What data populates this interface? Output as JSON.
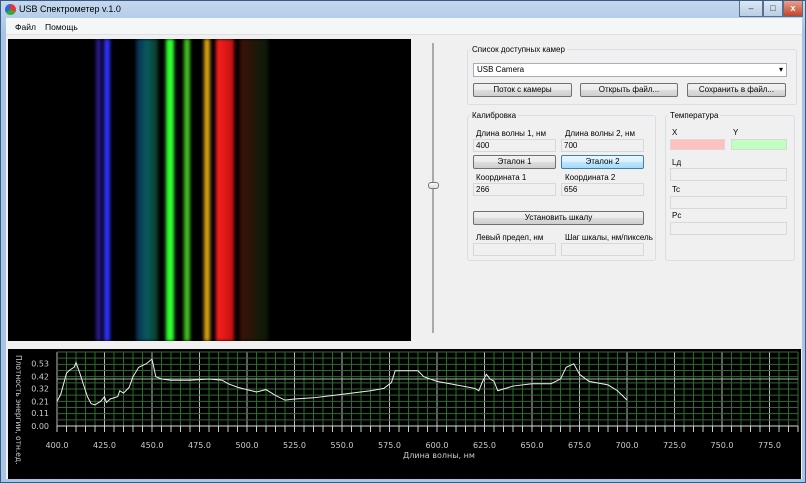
{
  "window": {
    "title": "USB Спектрометер v.1.0",
    "minimize": "–",
    "maximize": "□",
    "close": "x"
  },
  "menu": [
    "Файл",
    "Помощь"
  ],
  "cameras": {
    "group_label": "Список доступных камер",
    "selected": "USB Camera",
    "stream_button": "Поток с камеры",
    "open_button": "Открыть файл...",
    "save_button": "Сохранить в файл..."
  },
  "calibration": {
    "group_label": "Калибровка",
    "wl1_label": "Длина волны 1, нм",
    "wl1_value": "400",
    "wl2_label": "Длина волны 2, нм",
    "wl2_value": "700",
    "ref1_button": "Эталон 1",
    "ref2_button": "Эталон 2",
    "coord1_label": "Координата 1",
    "coord1_value": "266",
    "coord2_label": "Координата 2",
    "coord2_value": "656",
    "set_scale_button": "Установить шкалу",
    "left_limit_label": "Левый предел, нм",
    "left_limit_value": "",
    "step_label": "Шаг шкалы, нм/пиксель",
    "step_value": ""
  },
  "temperature": {
    "group_label": "Температура",
    "x_label": "X",
    "y_label": "Y",
    "x_color": "#ffc0c0",
    "y_color": "#c0ffc0",
    "ld_label": "Lд",
    "tc_label": "Tc",
    "pc_label": "Pc"
  },
  "chart_data": {
    "type": "line",
    "xlabel": "Длина волны, нм",
    "ylabel": "Плотность энергии, отн.ед.",
    "xlim": [
      400,
      790
    ],
    "ylim": [
      0,
      0.63
    ],
    "xticks": [
      "400.0",
      "425.0",
      "450.0",
      "475.0",
      "500.0",
      "525.0",
      "550.0",
      "575.0",
      "600.0",
      "625.0",
      "650.0",
      "675.0",
      "700.0",
      "725.0",
      "750.0",
      "775.0"
    ],
    "yticks": [
      "0.00",
      "0.11",
      "0.21",
      "0.32",
      "0.42",
      "0.53"
    ],
    "grid": true,
    "x": [
      400,
      402,
      405,
      407,
      409,
      410,
      412,
      414,
      416,
      418,
      420,
      423,
      425,
      426,
      428,
      432,
      433,
      435,
      438,
      440,
      443,
      447,
      450,
      452,
      455,
      460,
      470,
      480,
      487,
      490,
      495,
      500,
      505,
      510,
      515,
      520,
      525,
      535,
      545,
      555,
      565,
      572,
      576,
      578,
      590,
      593,
      600,
      610,
      620,
      622,
      624,
      626,
      628,
      630,
      632,
      640,
      650,
      660,
      665,
      668,
      672,
      675,
      680,
      690,
      695,
      700
    ],
    "y": [
      0.21,
      0.27,
      0.45,
      0.48,
      0.5,
      0.54,
      0.45,
      0.35,
      0.25,
      0.19,
      0.18,
      0.21,
      0.25,
      0.2,
      0.23,
      0.25,
      0.3,
      0.28,
      0.33,
      0.42,
      0.5,
      0.53,
      0.57,
      0.42,
      0.4,
      0.39,
      0.39,
      0.4,
      0.39,
      0.36,
      0.33,
      0.31,
      0.29,
      0.31,
      0.26,
      0.22,
      0.23,
      0.24,
      0.26,
      0.28,
      0.3,
      0.32,
      0.37,
      0.47,
      0.47,
      0.42,
      0.38,
      0.35,
      0.32,
      0.3,
      0.38,
      0.44,
      0.4,
      0.38,
      0.3,
      0.34,
      0.36,
      0.36,
      0.4,
      0.5,
      0.53,
      0.44,
      0.38,
      0.35,
      0.3,
      0.22
    ]
  }
}
